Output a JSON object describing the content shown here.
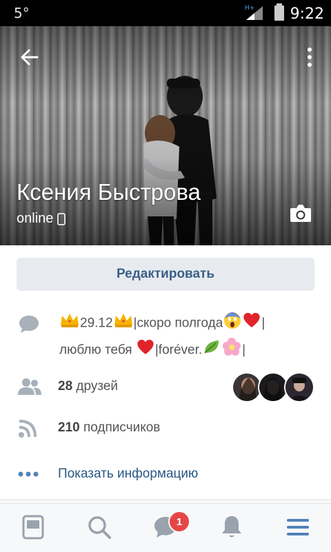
{
  "statusbar": {
    "temperature": "5°",
    "network": "H+",
    "time": "9:22"
  },
  "profile": {
    "name": "Ксения Быстрова",
    "online_status": "online",
    "edit_label": "Редактировать"
  },
  "status": {
    "line1_date": "29.12",
    "line1_text": "|скоро полгода",
    "line1_bar": "|",
    "line2_text": "люблю тебя",
    "line2_mid": "|forévеr.",
    "line2_end": "|"
  },
  "friends": {
    "count": "28",
    "label": "друзей"
  },
  "subscribers": {
    "count": "210",
    "label": "подписчиков"
  },
  "show_info_label": "Показать информацию",
  "tabbar": {
    "messages_badge": "1",
    "active_tab": "menu"
  },
  "colors": {
    "accent": "#2a5885",
    "badge": "#e64646",
    "icon_gray": "#99a2ad",
    "menu_active": "#5181b8"
  },
  "icons": [
    "back-arrow",
    "more-vertical",
    "camera",
    "phone",
    "speech-bubble",
    "friends",
    "rss",
    "dots",
    "newsfeed",
    "search",
    "messages",
    "bell",
    "menu"
  ]
}
